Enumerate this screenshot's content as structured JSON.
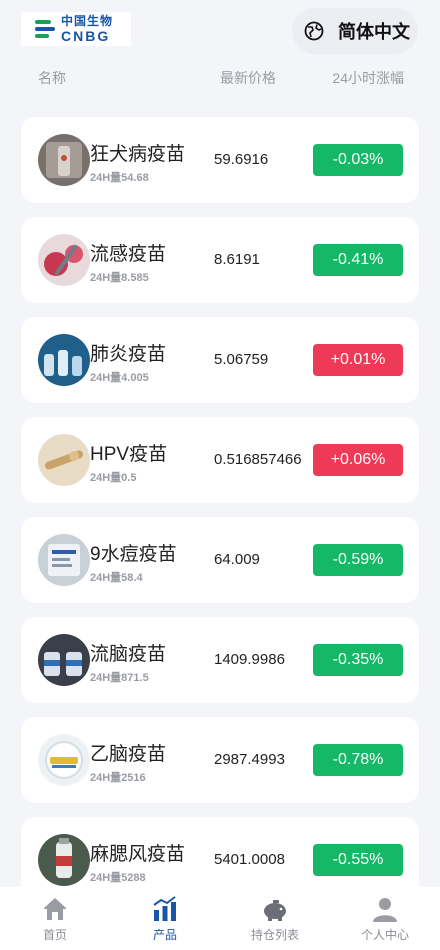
{
  "header": {
    "logo_cn": "中国生物",
    "logo_en": "CNBG",
    "language": "简体中文"
  },
  "columns": {
    "name": "名称",
    "price": "最新价格",
    "change": "24小时涨幅"
  },
  "products": [
    {
      "name": "狂犬病疫苗",
      "volume": "24H量54.68",
      "price": "59.6916",
      "change": "-0.03%",
      "trend": "down"
    },
    {
      "name": "流感疫苗",
      "volume": "24H量8.585",
      "price": "8.6191",
      "change": "-0.41%",
      "trend": "down"
    },
    {
      "name": "肺炎疫苗",
      "volume": "24H量4.005",
      "price": "5.06759",
      "change": "+0.01%",
      "trend": "up"
    },
    {
      "name": "HPV疫苗",
      "volume": "24H量0.5",
      "price": "0.516857466",
      "change": "+0.06%",
      "trend": "up"
    },
    {
      "name": "9水痘疫苗",
      "volume": "24H量58.4",
      "price": "64.009",
      "change": "-0.59%",
      "trend": "down"
    },
    {
      "name": "流脑疫苗",
      "volume": "24H量871.5",
      "price": "1409.9986",
      "change": "-0.35%",
      "trend": "down"
    },
    {
      "name": "乙脑疫苗",
      "volume": "24H量2516",
      "price": "2987.4993",
      "change": "-0.78%",
      "trend": "down"
    },
    {
      "name": "麻腮风疫苗",
      "volume": "24H量5288",
      "price": "5401.0008",
      "change": "-0.55%",
      "trend": "down"
    }
  ],
  "tabbar": [
    {
      "label": "首页",
      "icon": "home-icon",
      "active": false
    },
    {
      "label": "产品",
      "icon": "chart-icon",
      "active": true
    },
    {
      "label": "持仓列表",
      "icon": "piggy-bank-icon",
      "active": false
    },
    {
      "label": "个人中心",
      "icon": "user-icon",
      "active": false
    }
  ],
  "colors": {
    "up": "#ef3a57",
    "down": "#14b866",
    "brand": "#1a56a8"
  }
}
